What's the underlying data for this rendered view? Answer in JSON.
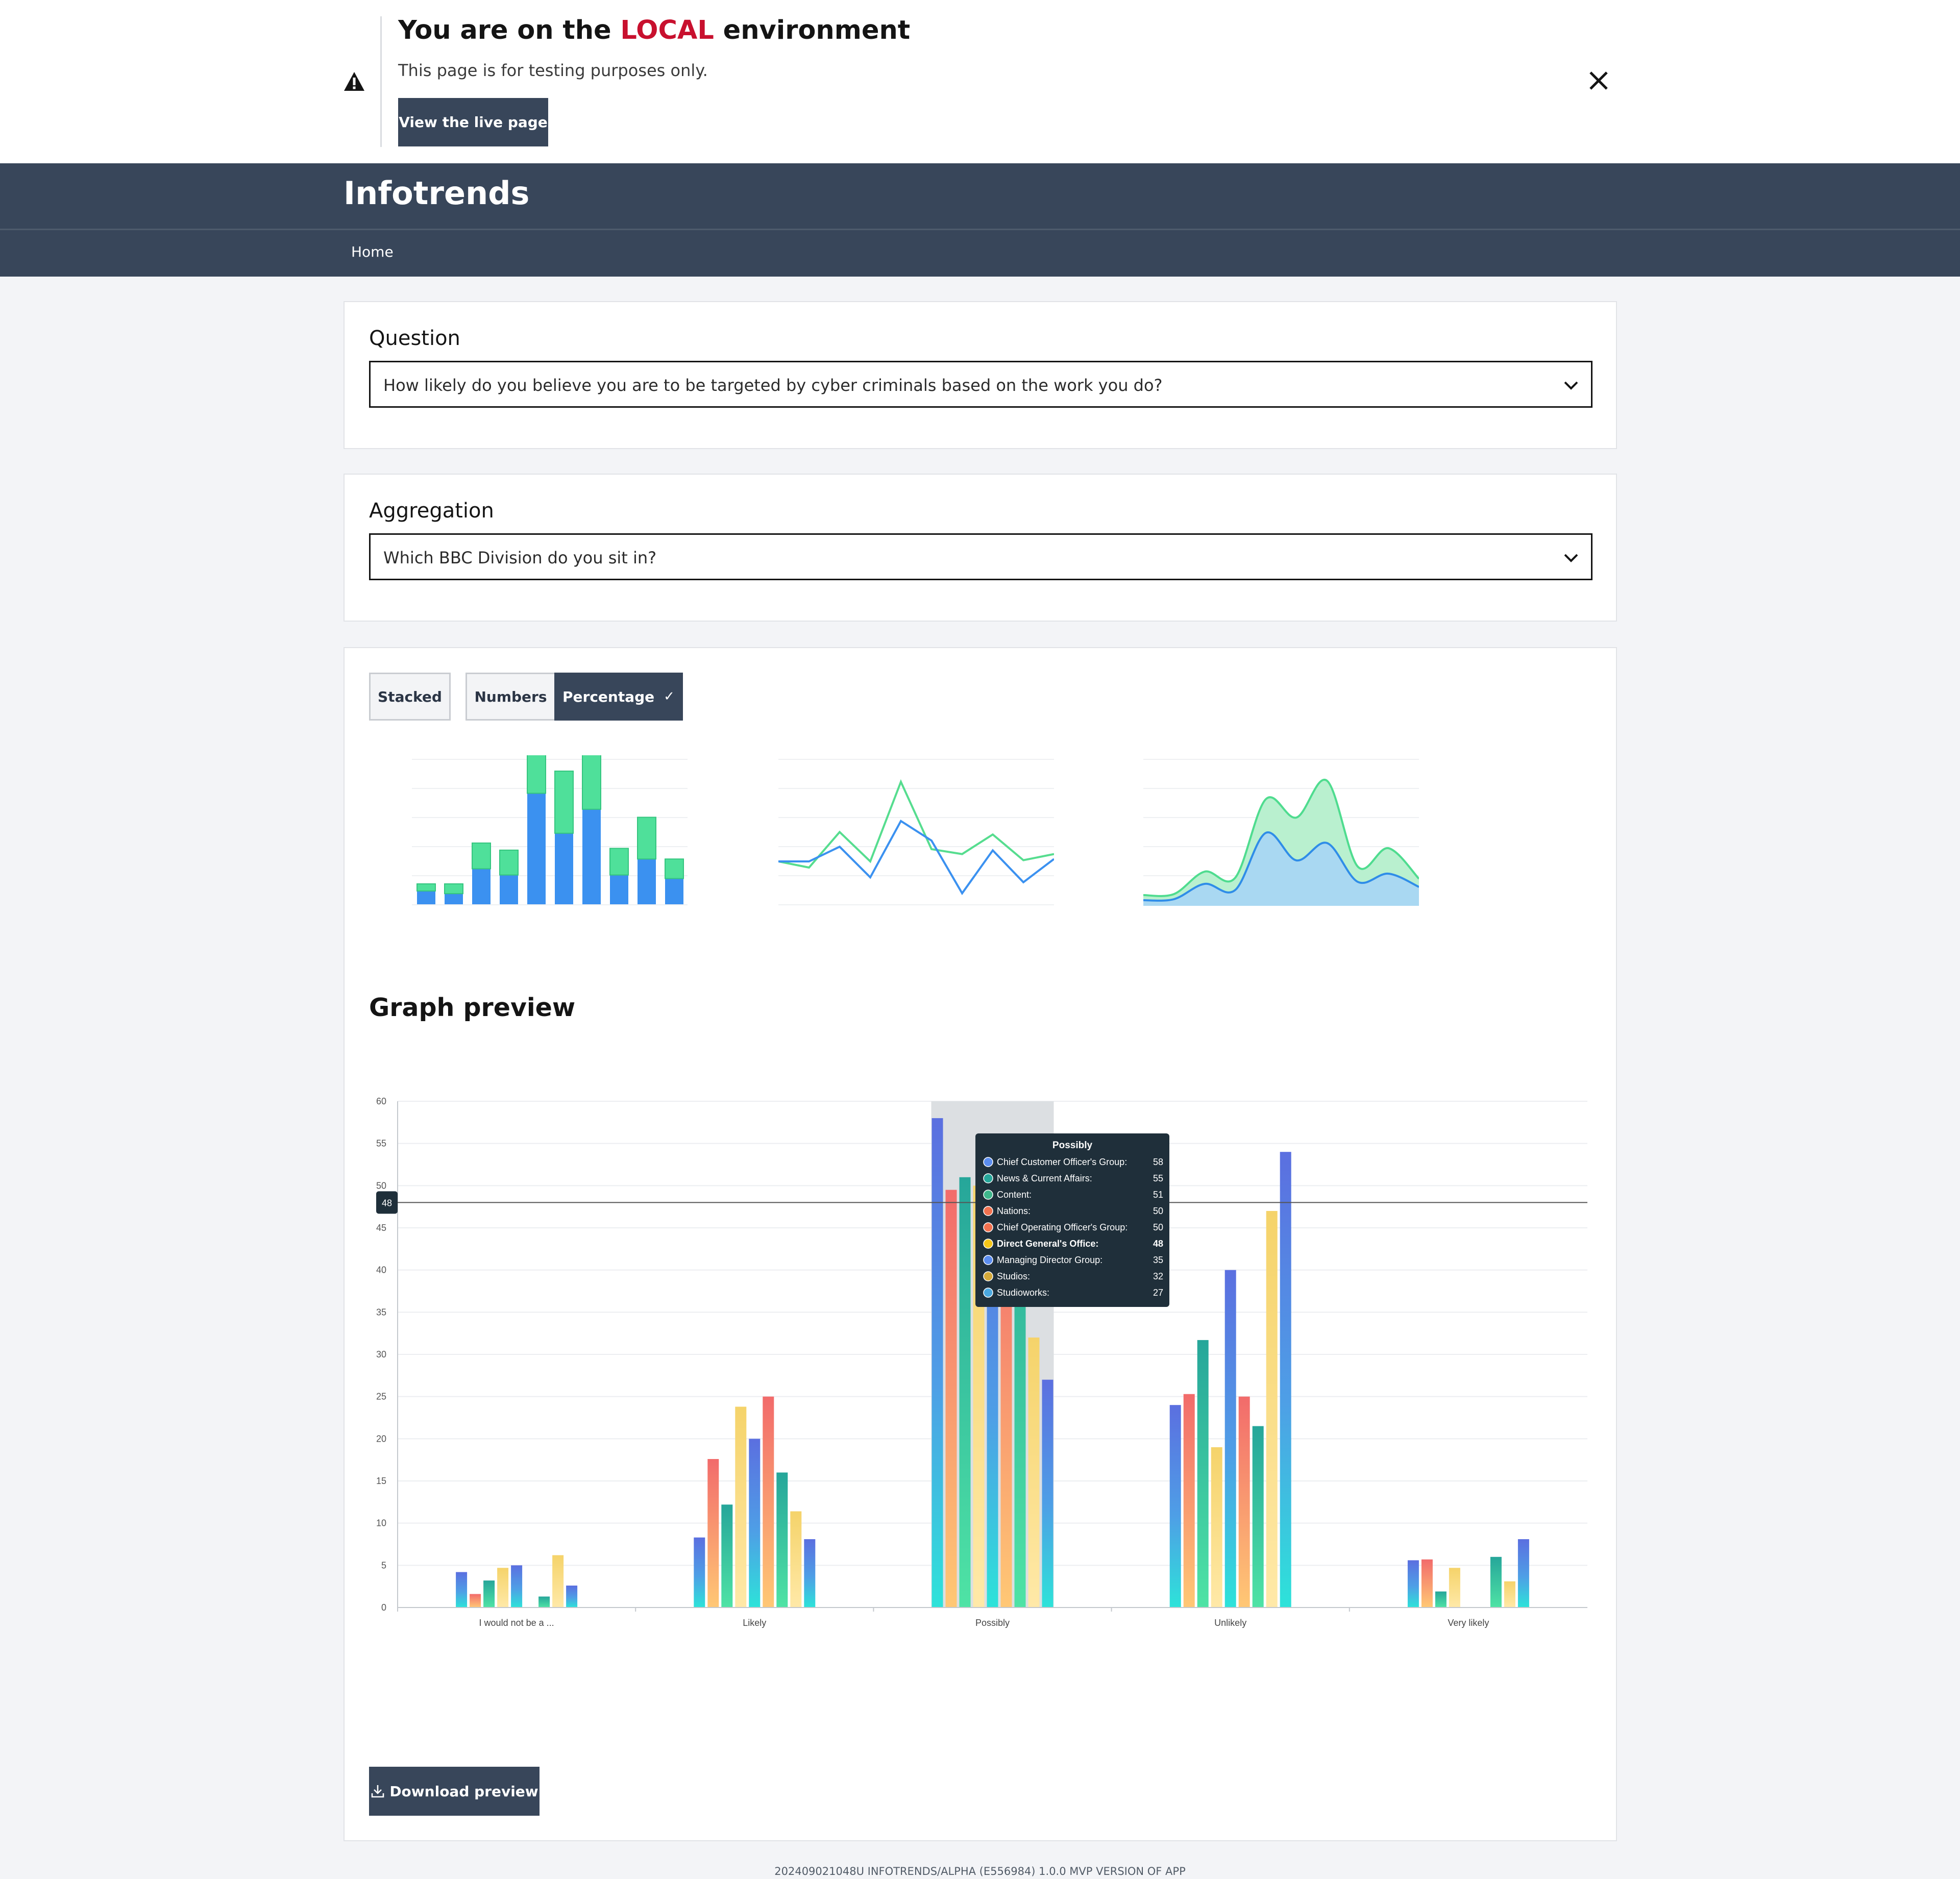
{
  "banner": {
    "title_prefix": "You are on the ",
    "env": "LOCAL",
    "title_suffix": " environment",
    "subtitle": "This page is for testing purposes only.",
    "live_button": "View the live page",
    "warning_icon": "warning-icon",
    "close_icon": "close-icon"
  },
  "header": {
    "brand": "Infotrends",
    "nav": [
      {
        "label": "Home"
      }
    ]
  },
  "question": {
    "label": "Question",
    "value": "How likely do you believe you are to be targeted by cyber criminals based on the work you do?"
  },
  "aggregation": {
    "label": "Aggregation",
    "value": "Which BBC Division do you sit in?"
  },
  "chart_controls": {
    "stacked": "Stacked",
    "numbers": "Numbers",
    "percentage": "Percentage",
    "percentage_selected": true,
    "percentage_tick": "✓"
  },
  "graph_preview": {
    "title": "Graph preview"
  },
  "colors": {
    "dark": "#38465a",
    "env_red": "#c8102e"
  },
  "chart_data": {
    "type": "bar",
    "categories": [
      "I would not be a ...",
      "Likely",
      "Possibly",
      "Unlikely",
      "Very likely"
    ],
    "ylim": [
      0,
      60
    ],
    "yticks": [
      0,
      5,
      10,
      15,
      20,
      25,
      30,
      35,
      40,
      45,
      50,
      55,
      60
    ],
    "grid": true,
    "series": [
      {
        "name": "Chief Customer Officer's Group",
        "color": "#5b6fe0",
        "values": [
          4.2,
          8.3,
          58,
          24,
          5.6
        ]
      },
      {
        "name": "News & Current Affairs",
        "color": "#f26b6b",
        "values": [
          1.6,
          17.6,
          49.5,
          25.3,
          5.7
        ]
      },
      {
        "name": "Content",
        "color": "#26a69a",
        "values": [
          3.2,
          12.2,
          51,
          31.7,
          1.9
        ]
      },
      {
        "name": "Nations",
        "color": "#f5d36a",
        "values": [
          4.7,
          23.8,
          50,
          19,
          4.7
        ]
      },
      {
        "name": "Chief Operating Officer's Group",
        "color": "#5b6fe0",
        "values": [
          5,
          20,
          50,
          40,
          null
        ]
      },
      {
        "name": "Direct General's Office",
        "color": "#f26b6b",
        "values": [
          null,
          25,
          48,
          25,
          null
        ]
      },
      {
        "name": "Managing Director Group",
        "color": "#26a69a",
        "values": [
          1.3,
          16,
          55,
          21.5,
          6
        ]
      },
      {
        "name": "Studios",
        "color": "#f5d36a",
        "values": [
          6.2,
          11.4,
          32,
          47,
          3.1
        ]
      },
      {
        "name": "Studioworks",
        "color": "#5b6fe0",
        "values": [
          2.6,
          8.1,
          27,
          54,
          8.1
        ]
      }
    ],
    "tooltip": {
      "title": "Possibly",
      "rows": [
        {
          "name": "Chief Customer Officer's Group:",
          "value": 58,
          "dot": "#5b8def"
        },
        {
          "name": "News & Current Affairs:",
          "value": 55,
          "dot": "#26a69a"
        },
        {
          "name": "Content:",
          "value": 51,
          "dot": "#3fb68b"
        },
        {
          "name": "Nations:",
          "value": 50,
          "dot": "#f2714f"
        },
        {
          "name": "Chief Operating Officer's Group:",
          "value": 50,
          "dot": "#f2714f"
        },
        {
          "name": "Direct General's Office:",
          "value": 48,
          "dot": "#f5c518",
          "highlight": true
        },
        {
          "name": "Managing Director Group:",
          "value": 35,
          "dot": "#5b8def"
        },
        {
          "name": "Studios:",
          "value": 32,
          "dot": "#d4a93a"
        },
        {
          "name": "Studioworks:",
          "value": 27,
          "dot": "#4aa8e0"
        }
      ]
    },
    "crosshair_value": 48,
    "axis_pointer_label": "Possibly"
  },
  "thumbnails": {
    "bar": {
      "bottom": [
        1.5,
        1.2,
        4,
        3.3,
        12.5,
        8,
        10.7,
        3.3,
        5.1,
        2.9
      ],
      "top": [
        0.8,
        1.1,
        2.9,
        2.8,
        5,
        7,
        10,
        3,
        4.7,
        2.2
      ]
    },
    "line": {
      "a": [
        3,
        2.5,
        5.4,
        3,
        9.5,
        4,
        3.6,
        5.2,
        3.1,
        3.6
      ],
      "b": [
        3,
        3,
        4.2,
        1.7,
        6.3,
        4.7,
        0.4,
        3.9,
        1.3,
        3.2
      ]
    },
    "area": {
      "a": [
        0.8,
        0.9,
        3.1,
        2.5,
        10.2,
        8.4,
        12,
        3.6,
        5.4,
        2.4
      ],
      "b": [
        0.3,
        0.4,
        1.9,
        1.3,
        6.9,
        4.2,
        5.9,
        2.1,
        2.9,
        1.6
      ]
    }
  },
  "download": {
    "label": "Download preview",
    "icon": "download-icon"
  },
  "footer": {
    "text": "202409021048U INFOTRENDS/ALPHA (E556984) 1.0.0 MVP VERSION OF APP"
  }
}
